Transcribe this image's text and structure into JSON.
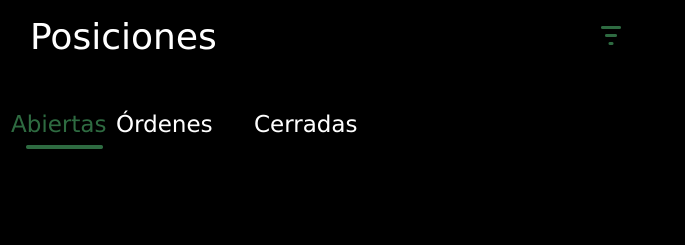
{
  "header": {
    "title": "Posiciones",
    "filter_icon": "filter-icon"
  },
  "tabs": [
    {
      "label": "Abiertas",
      "active": true
    },
    {
      "label": "Órdenes",
      "active": false
    },
    {
      "label": "Cerradas",
      "active": false
    }
  ],
  "colors": {
    "background": "#000000",
    "text": "#ffffff",
    "accent": "#2e6b41"
  }
}
